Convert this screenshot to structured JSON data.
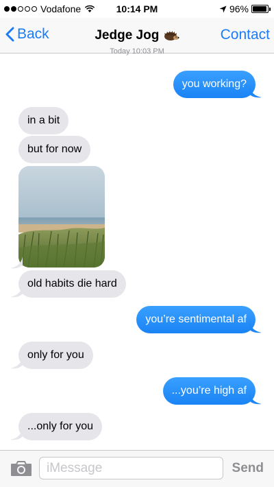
{
  "status_bar": {
    "signal_dots": [
      true,
      true,
      false,
      false,
      false
    ],
    "carrier": "Vodafone",
    "time": "10:14 PM",
    "battery": "96%",
    "battery_level": 0.96
  },
  "nav": {
    "back_label": "Back",
    "title": "Jedge Jog",
    "contact_label": "Contact",
    "accent_color": "#1a7cf5"
  },
  "timestamp": "Today 10:03 PM",
  "messages": [
    {
      "from": "me",
      "text": "you working?"
    },
    {
      "from": "them",
      "text": "in a bit"
    },
    {
      "from": "them",
      "text": "but for now"
    },
    {
      "from": "them",
      "type": "image",
      "icon": "beach-dunes-photo"
    },
    {
      "from": "them",
      "text": "old habits die hard"
    },
    {
      "from": "me",
      "text": "you’re sentimental af"
    },
    {
      "from": "them",
      "text": "only for you"
    },
    {
      "from": "me",
      "text": "...you’re high af"
    },
    {
      "from": "them",
      "text": "...only for you"
    }
  ],
  "composer": {
    "placeholder": "iMessage",
    "value": "",
    "send_label": "Send",
    "camera_icon": "camera-icon"
  },
  "colors": {
    "outgoing_bubble": "#1a8cff",
    "incoming_bubble": "#e5e5ea"
  }
}
